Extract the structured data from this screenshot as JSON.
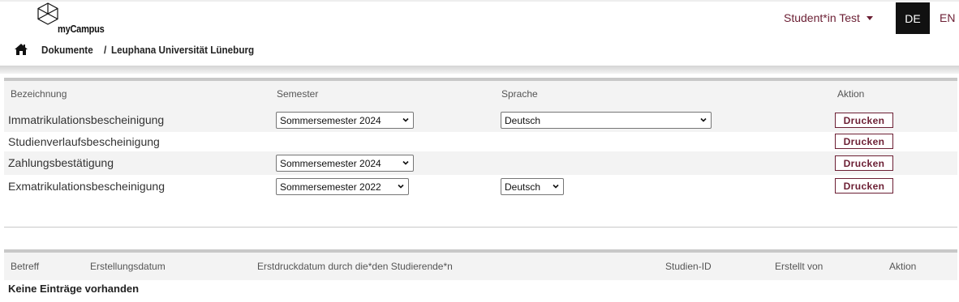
{
  "header": {
    "app_name": "myCampus",
    "user_name": "Student*in Test",
    "lang_de": "DE",
    "lang_en": "EN"
  },
  "breadcrumb": {
    "section": "Dokumente",
    "separator": "/",
    "page": "Leuphana Universität Lüneburg"
  },
  "documents_table": {
    "headers": {
      "name": "Bezeichnung",
      "semester": "Semester",
      "language": "Sprache",
      "action": "Aktion"
    },
    "rows": [
      {
        "name": "Immatrikulationsbescheinigung",
        "semester": "Sommersemester 2024",
        "language": "Deutsch",
        "action": "Drucken"
      },
      {
        "name": "Studienverlaufsbescheinigung",
        "action": "Drucken"
      },
      {
        "name": "Zahlungsbestätigung",
        "semester": "Sommersemester 2024",
        "action": "Drucken"
      },
      {
        "name": "Exmatrikulationsbescheinigung",
        "semester": "Sommersemester 2022",
        "language": "Deutsch",
        "action": "Drucken"
      }
    ]
  },
  "history_table": {
    "headers": {
      "subject": "Betreff",
      "created": "Erstellungsdatum",
      "first_print": "Erstdruckdatum durch die*den Studierende*n",
      "student_id": "Studien-ID",
      "created_by": "Erstellt von",
      "action": "Aktion"
    },
    "empty_message": "Keine Einträge vorhanden"
  },
  "colors": {
    "accent": "#6b1e33",
    "header_row_bg": "#f3f3f3",
    "lang_active_bg": "#111111"
  },
  "icons": {
    "logo": "cube-logo-icon",
    "home": "home-icon",
    "dropdown": "caret-down-icon"
  }
}
